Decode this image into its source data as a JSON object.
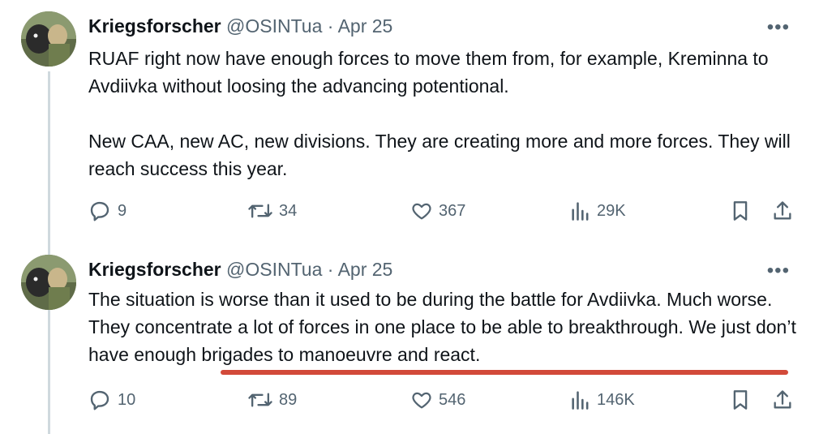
{
  "tweets": [
    {
      "name": "Kriegsforscher",
      "handle": "@OSINTua",
      "sep": "·",
      "date": "Apr 25",
      "more": "•••",
      "paragraphs": [
        "RUAF right now have enough forces to move them from, for example, Kreminna to Avdiivka without loosing the advancing potentional.",
        "New CAA, new AC, new divisions. They are creating more and more forces. They will reach success this year."
      ],
      "replies": "9",
      "reposts": "34",
      "likes": "367",
      "views": "29K"
    },
    {
      "name": "Kriegsforscher",
      "handle": "@OSINTua",
      "sep": "·",
      "date": "Apr 25",
      "more": "•••",
      "text_plain": "The situation is worse than it used to be during the battle for Avdiivka. Much worse. They concentrate a lot of forces in one place to be able to breakthrough. ",
      "text_highlight": "We just don’t have enough brigades to manoeuvre and react.",
      "highlight_color": "#d24a3a",
      "replies": "10",
      "reposts": "89",
      "likes": "546",
      "views": "146K"
    }
  ],
  "icons": [
    "reply-icon",
    "repost-icon",
    "like-icon",
    "views-icon",
    "bookmark-icon",
    "share-icon",
    "more-icon"
  ]
}
